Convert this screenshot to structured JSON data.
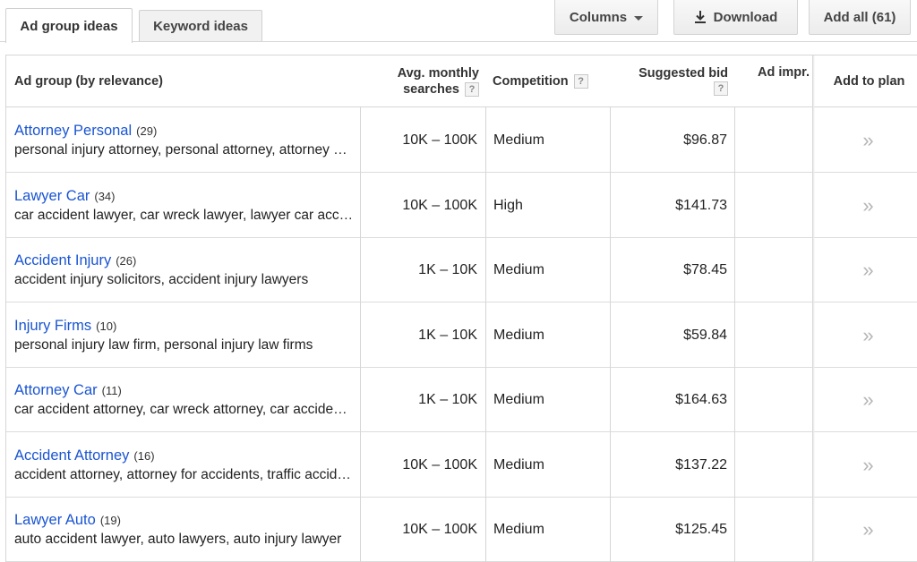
{
  "tabs": [
    {
      "label": "Ad group ideas",
      "active": true
    },
    {
      "label": "Keyword ideas",
      "active": false
    }
  ],
  "toolbar": {
    "columns_label": "Columns",
    "download_label": "Download",
    "add_all_label": "Add all (61)"
  },
  "table": {
    "headers": {
      "group": "Ad group (by relevance)",
      "searches_line1": "Avg. monthly",
      "searches_line2": "searches",
      "competition": "Competition",
      "bid": "Suggested bid",
      "impr": "Ad impr.",
      "add": "Add to plan",
      "help": "?"
    },
    "add_icon": "»",
    "rows": [
      {
        "title": "Attorney Personal",
        "count": "(29)",
        "keywords": "personal injury attorney, personal attorney, attorney personal injury",
        "searches": "10K – 100K",
        "competition": "Medium",
        "bid": "$96.87"
      },
      {
        "title": "Lawyer Car",
        "count": "(34)",
        "keywords": "car accident lawyer, car wreck lawyer, lawyer car accident",
        "searches": "10K – 100K",
        "competition": "High",
        "bid": "$141.73"
      },
      {
        "title": "Accident Injury",
        "count": "(26)",
        "keywords": "accident injury solicitors, accident injury lawyers",
        "searches": "1K – 10K",
        "competition": "Medium",
        "bid": "$78.45"
      },
      {
        "title": "Injury Firms",
        "count": "(10)",
        "keywords": "personal injury law firm, personal injury law firms",
        "searches": "1K – 10K",
        "competition": "Medium",
        "bid": "$59.84"
      },
      {
        "title": "Attorney Car",
        "count": "(11)",
        "keywords": "car accident attorney, car wreck attorney, car accident attorneys",
        "searches": "1K – 10K",
        "competition": "Medium",
        "bid": "$164.63"
      },
      {
        "title": "Accident Attorney",
        "count": "(16)",
        "keywords": "accident attorney, attorney for accidents, traffic accident attorney",
        "searches": "10K – 100K",
        "competition": "Medium",
        "bid": "$137.22"
      },
      {
        "title": "Lawyer Auto",
        "count": "(19)",
        "keywords": "auto accident lawyer, auto lawyers, auto injury lawyer",
        "searches": "10K – 100K",
        "competition": "Medium",
        "bid": "$125.45"
      }
    ]
  }
}
